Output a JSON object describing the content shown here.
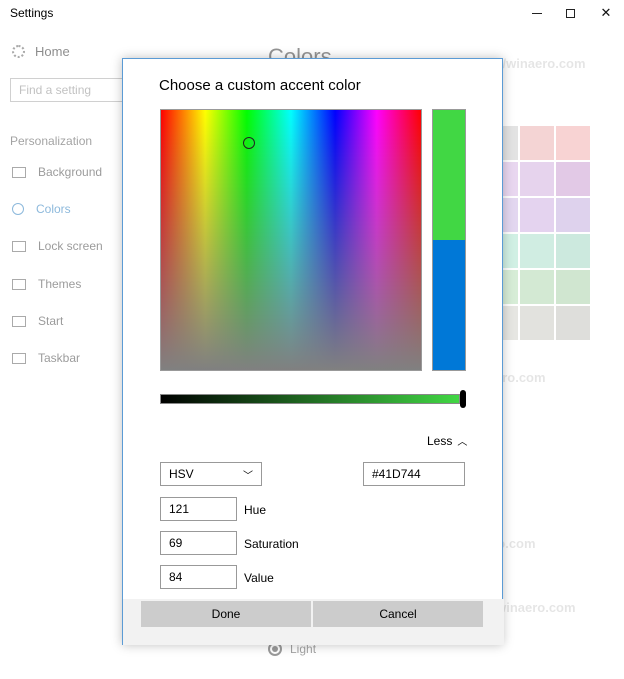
{
  "window": {
    "title": "Settings",
    "min_glyph": "—",
    "max_glyph": "",
    "close_glyph": "✕"
  },
  "background": {
    "home_label": "Home",
    "search_placeholder": "Find a setting",
    "section_label": "Personalization",
    "nav_items": [
      {
        "label": "Background",
        "icon": "image-icon"
      },
      {
        "label": "Colors",
        "icon": "palette-icon",
        "active": true
      },
      {
        "label": "Lock screen",
        "icon": "lock-screen-icon"
      },
      {
        "label": "Themes",
        "icon": "themes-icon"
      },
      {
        "label": "Start",
        "icon": "start-icon"
      },
      {
        "label": "Taskbar",
        "icon": "taskbar-icon"
      }
    ],
    "page_heading": "Colors",
    "light_option": "Light",
    "swatch_colors": [
      "#c2c2c2",
      "#e8a2a2",
      "#f0a0a0",
      "#cfa8e0",
      "#c8a0d8",
      "#c088c8",
      "#c2a8e0",
      "#c4a0dc",
      "#b89cd8",
      "#9ae0c4",
      "#98d8c0",
      "#90d0b8",
      "#a8d8a8",
      "#a0d0a0",
      "#98c898",
      "#c8c8c0",
      "#c0c0b8",
      "#b8b8b0"
    ]
  },
  "watermark": "http://winaero.com",
  "dialog": {
    "title": "Choose a custom accent color",
    "less_label": "Less",
    "mode_value": "HSV",
    "hex_value": "#41D744",
    "hue_value": "121",
    "hue_label": "Hue",
    "saturation_value": "69",
    "saturation_label": "Saturation",
    "value_value": "84",
    "value_label": "Value",
    "done_label": "Done",
    "cancel_label": "Cancel",
    "new_color": "#41D744",
    "old_color": "#0078D7"
  }
}
